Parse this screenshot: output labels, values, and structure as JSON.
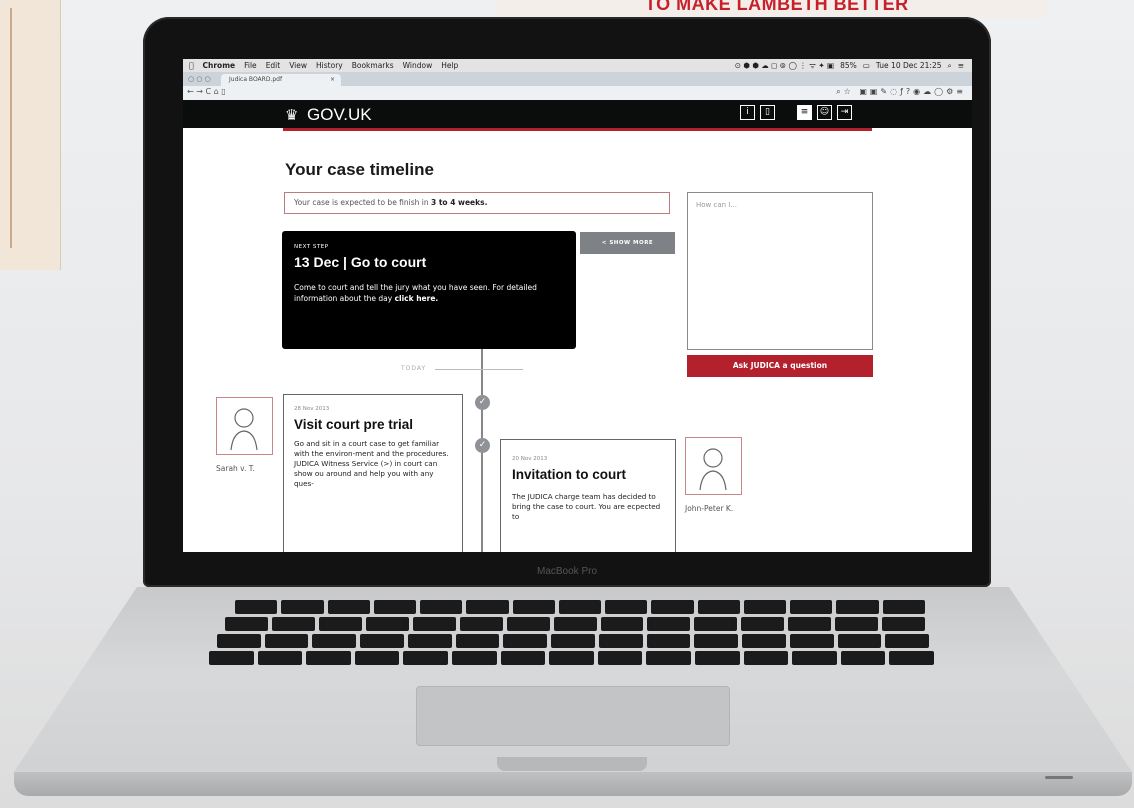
{
  "background": {
    "poster_text": "TO MAKE LAMBETH BETTER"
  },
  "laptop": {
    "brand": "MacBook Pro"
  },
  "menubar": {
    "apple_icon": "apple-icon",
    "items": [
      "Chrome",
      "File",
      "Edit",
      "View",
      "History",
      "Bookmarks",
      "Window",
      "Help"
    ],
    "battery": "85%",
    "datetime": "Tue 10 Dec 21:25"
  },
  "browser": {
    "tab_title": "Judica BOARD.pdf"
  },
  "gov": {
    "logo": "GOV.UK"
  },
  "page": {
    "title": "Your case timeline",
    "expect_prefix": "Your case is expected to be finish in ",
    "expect_bold": "3 to 4 weeks.",
    "next_step_label": "NEXT STEP",
    "next_step_heading": "13 Dec | Go to court",
    "next_step_body": "Come to court and tell the jury what you have seen. For detailed information about the day ",
    "next_step_link": "click here.",
    "show_more": "< SHOW MORE",
    "question_placeholder": "How can I...",
    "ask_button": "Ask JUDICA a question",
    "today_label": "TODAY"
  },
  "timeline": [
    {
      "date": "28 Nov 2013",
      "heading": "Visit court pre trial",
      "text": "Go and sit in a court case to get familiar with the environ-ment and the procedures. JUDICA Witness Service (>) in court can show ou around and help you with any ques-",
      "person": "Sarah v. T."
    },
    {
      "date": "20 Nov 2013",
      "heading": "Invitation to court",
      "text": "The JUDICA charge team has decided to bring the case to court. You are ecpected to",
      "person": "John-Peter K."
    }
  ],
  "colors": {
    "gov_red": "#b3212d",
    "gov_black": "#0b0c0c",
    "show_more_grey": "#7e8185"
  }
}
